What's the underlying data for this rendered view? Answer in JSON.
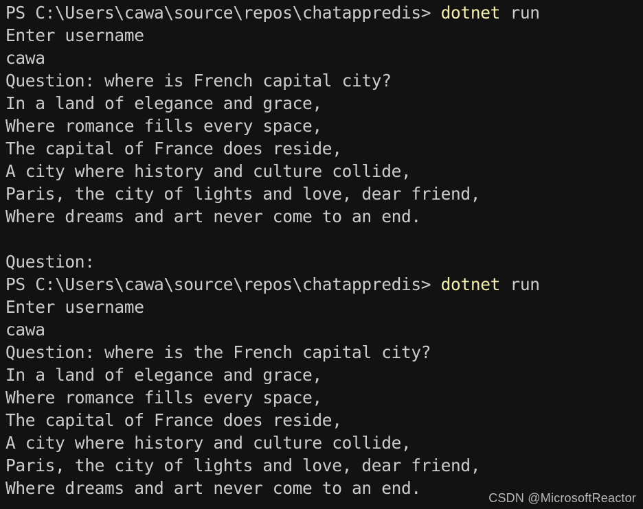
{
  "terminal": {
    "background_color": "#121212",
    "text_color": "#cccccc",
    "command_color": "#f5f0a8",
    "lines": [
      {
        "segments": [
          {
            "text": "PS C:\\Users\\cawa\\source\\repos\\chatappredis> ",
            "style": "plain"
          },
          {
            "text": "dotnet",
            "style": "cmd"
          },
          {
            "text": " run",
            "style": "plain"
          }
        ]
      },
      {
        "segments": [
          {
            "text": "Enter username",
            "style": "plain"
          }
        ]
      },
      {
        "segments": [
          {
            "text": "cawa",
            "style": "plain"
          }
        ]
      },
      {
        "segments": [
          {
            "text": "Question: where is French capital city?",
            "style": "plain"
          }
        ]
      },
      {
        "segments": [
          {
            "text": "In a land of elegance and grace,",
            "style": "plain"
          }
        ]
      },
      {
        "segments": [
          {
            "text": "Where romance fills every space,",
            "style": "plain"
          }
        ]
      },
      {
        "segments": [
          {
            "text": "The capital of France does reside,",
            "style": "plain"
          }
        ]
      },
      {
        "segments": [
          {
            "text": "A city where history and culture collide,",
            "style": "plain"
          }
        ]
      },
      {
        "segments": [
          {
            "text": "Paris, the city of lights and love, dear friend,",
            "style": "plain"
          }
        ]
      },
      {
        "segments": [
          {
            "text": "Where dreams and art never come to an end.",
            "style": "plain"
          }
        ]
      },
      {
        "segments": [
          {
            "text": "",
            "style": "plain"
          }
        ]
      },
      {
        "segments": [
          {
            "text": "Question:",
            "style": "plain"
          }
        ]
      },
      {
        "segments": [
          {
            "text": "PS C:\\Users\\cawa\\source\\repos\\chatappredis> ",
            "style": "plain"
          },
          {
            "text": "dotnet",
            "style": "cmd"
          },
          {
            "text": " run",
            "style": "plain"
          }
        ]
      },
      {
        "segments": [
          {
            "text": "Enter username",
            "style": "plain"
          }
        ]
      },
      {
        "segments": [
          {
            "text": "cawa",
            "style": "plain"
          }
        ]
      },
      {
        "segments": [
          {
            "text": "Question: where is the French capital city?",
            "style": "plain"
          }
        ]
      },
      {
        "segments": [
          {
            "text": "In a land of elegance and grace,",
            "style": "plain"
          }
        ]
      },
      {
        "segments": [
          {
            "text": "Where romance fills every space,",
            "style": "plain"
          }
        ]
      },
      {
        "segments": [
          {
            "text": "The capital of France does reside,",
            "style": "plain"
          }
        ]
      },
      {
        "segments": [
          {
            "text": "A city where history and culture collide,",
            "style": "plain"
          }
        ]
      },
      {
        "segments": [
          {
            "text": "Paris, the city of lights and love, dear friend,",
            "style": "plain"
          }
        ]
      },
      {
        "segments": [
          {
            "text": "Where dreams and art never come to an end.",
            "style": "plain"
          }
        ]
      }
    ]
  },
  "watermark": {
    "text": "CSDN @MicrosoftReactor"
  }
}
